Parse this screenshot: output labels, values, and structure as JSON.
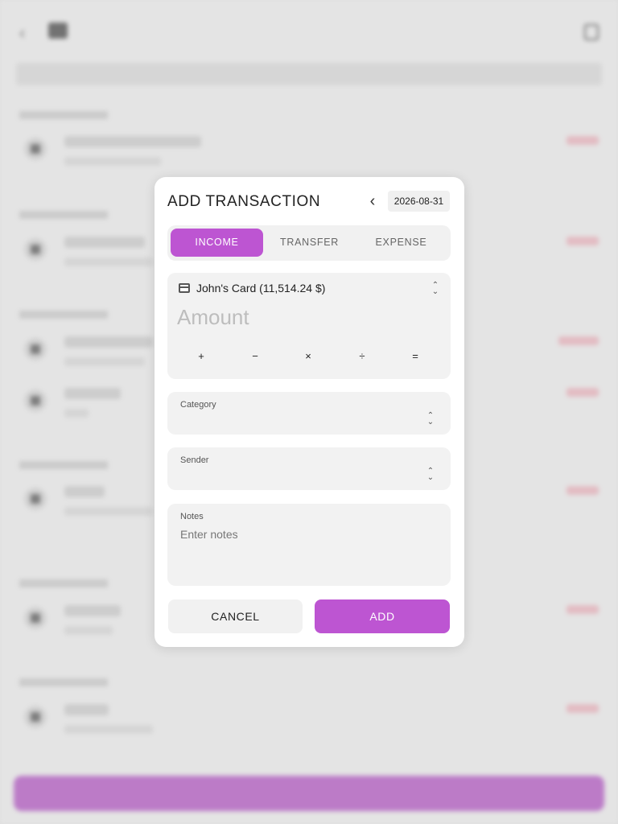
{
  "dialog": {
    "title": "ADD TRANSACTION",
    "date": "2026-08-31",
    "prev_icon": "chevron-left-icon",
    "types": [
      "INCOME",
      "TRANSFER",
      "EXPENSE"
    ],
    "active_type": "INCOME",
    "account_label": "John's Card (11,514.24 $)",
    "amount_placeholder": "Amount",
    "operators": [
      "+",
      "−",
      "×",
      "÷",
      "="
    ],
    "category_label": "Category",
    "sender_label": "Sender",
    "notes_label": "Notes",
    "notes_placeholder": "Enter notes",
    "cancel_label": "CANCEL",
    "add_label": "ADD"
  },
  "colors": {
    "accent": "#bd55d2",
    "expense_amount": "#e0546a",
    "field_bg": "#f2f2f2"
  }
}
